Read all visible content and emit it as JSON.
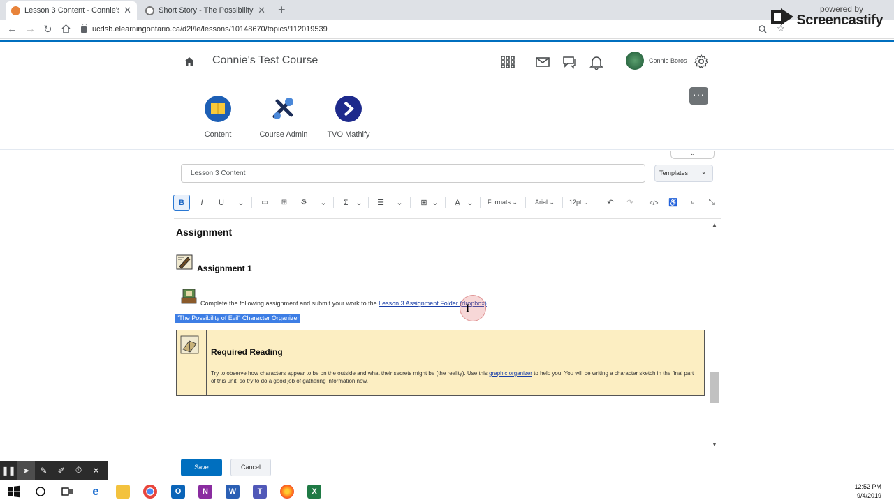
{
  "browser": {
    "tabs": [
      {
        "title": "Lesson 3 Content - Connie's Test",
        "active": true
      },
      {
        "title": "Short Story - The Possibility of Ev",
        "active": false
      }
    ],
    "url": "ucdsb.elearningontario.ca/d2l/le/lessons/10148670/topics/112019539",
    "overlay": {
      "powered_by": "powered by",
      "brand": "Screencastify"
    }
  },
  "header": {
    "course_title": "Connie's Test Course",
    "user_name": "Connie Boros"
  },
  "navbar": {
    "items": [
      {
        "label": "Content",
        "icon": "content-icon"
      },
      {
        "label": "Course Admin",
        "icon": "course-admin-icon"
      },
      {
        "label": "TVO Mathify",
        "icon": "tvo-mathify-icon"
      }
    ],
    "more_label": "···"
  },
  "editor": {
    "title_value": "Lesson 3 Content",
    "templates_label": "Templates",
    "toolbar": {
      "bold": "B",
      "italic": "I",
      "underline": "U",
      "sigma": "Σ",
      "formats": "Formats",
      "font": "Arial",
      "size": "12pt"
    },
    "content": {
      "heading": "Assignment",
      "subheading": "Assignment 1",
      "instruction": "Complete the following assignment and submit your work to the",
      "dropbox_link": "Lesson 3 Assignment Folder (dropbox)",
      "selected_link": "\"The Possibility of Evil\" Character Organizer",
      "reading_title": "Required Reading",
      "reading_text_1": "Try to observe how characters appear to be on the outside and what their secrets might be (the reality). Use this",
      "reading_link": "graphic organizer",
      "reading_text_2": "to help you. You will be writing a character sketch in the final part of this unit, so try to do a good job of gathering information now."
    }
  },
  "actions": {
    "save": "Save",
    "cancel": "Cancel"
  },
  "taskbar": {
    "time": "12:52 PM",
    "date": "9/4/2019"
  },
  "colors": {
    "accent": "#006fbf",
    "reading_box": "#fceec2",
    "selection": "#3d7ee5"
  }
}
